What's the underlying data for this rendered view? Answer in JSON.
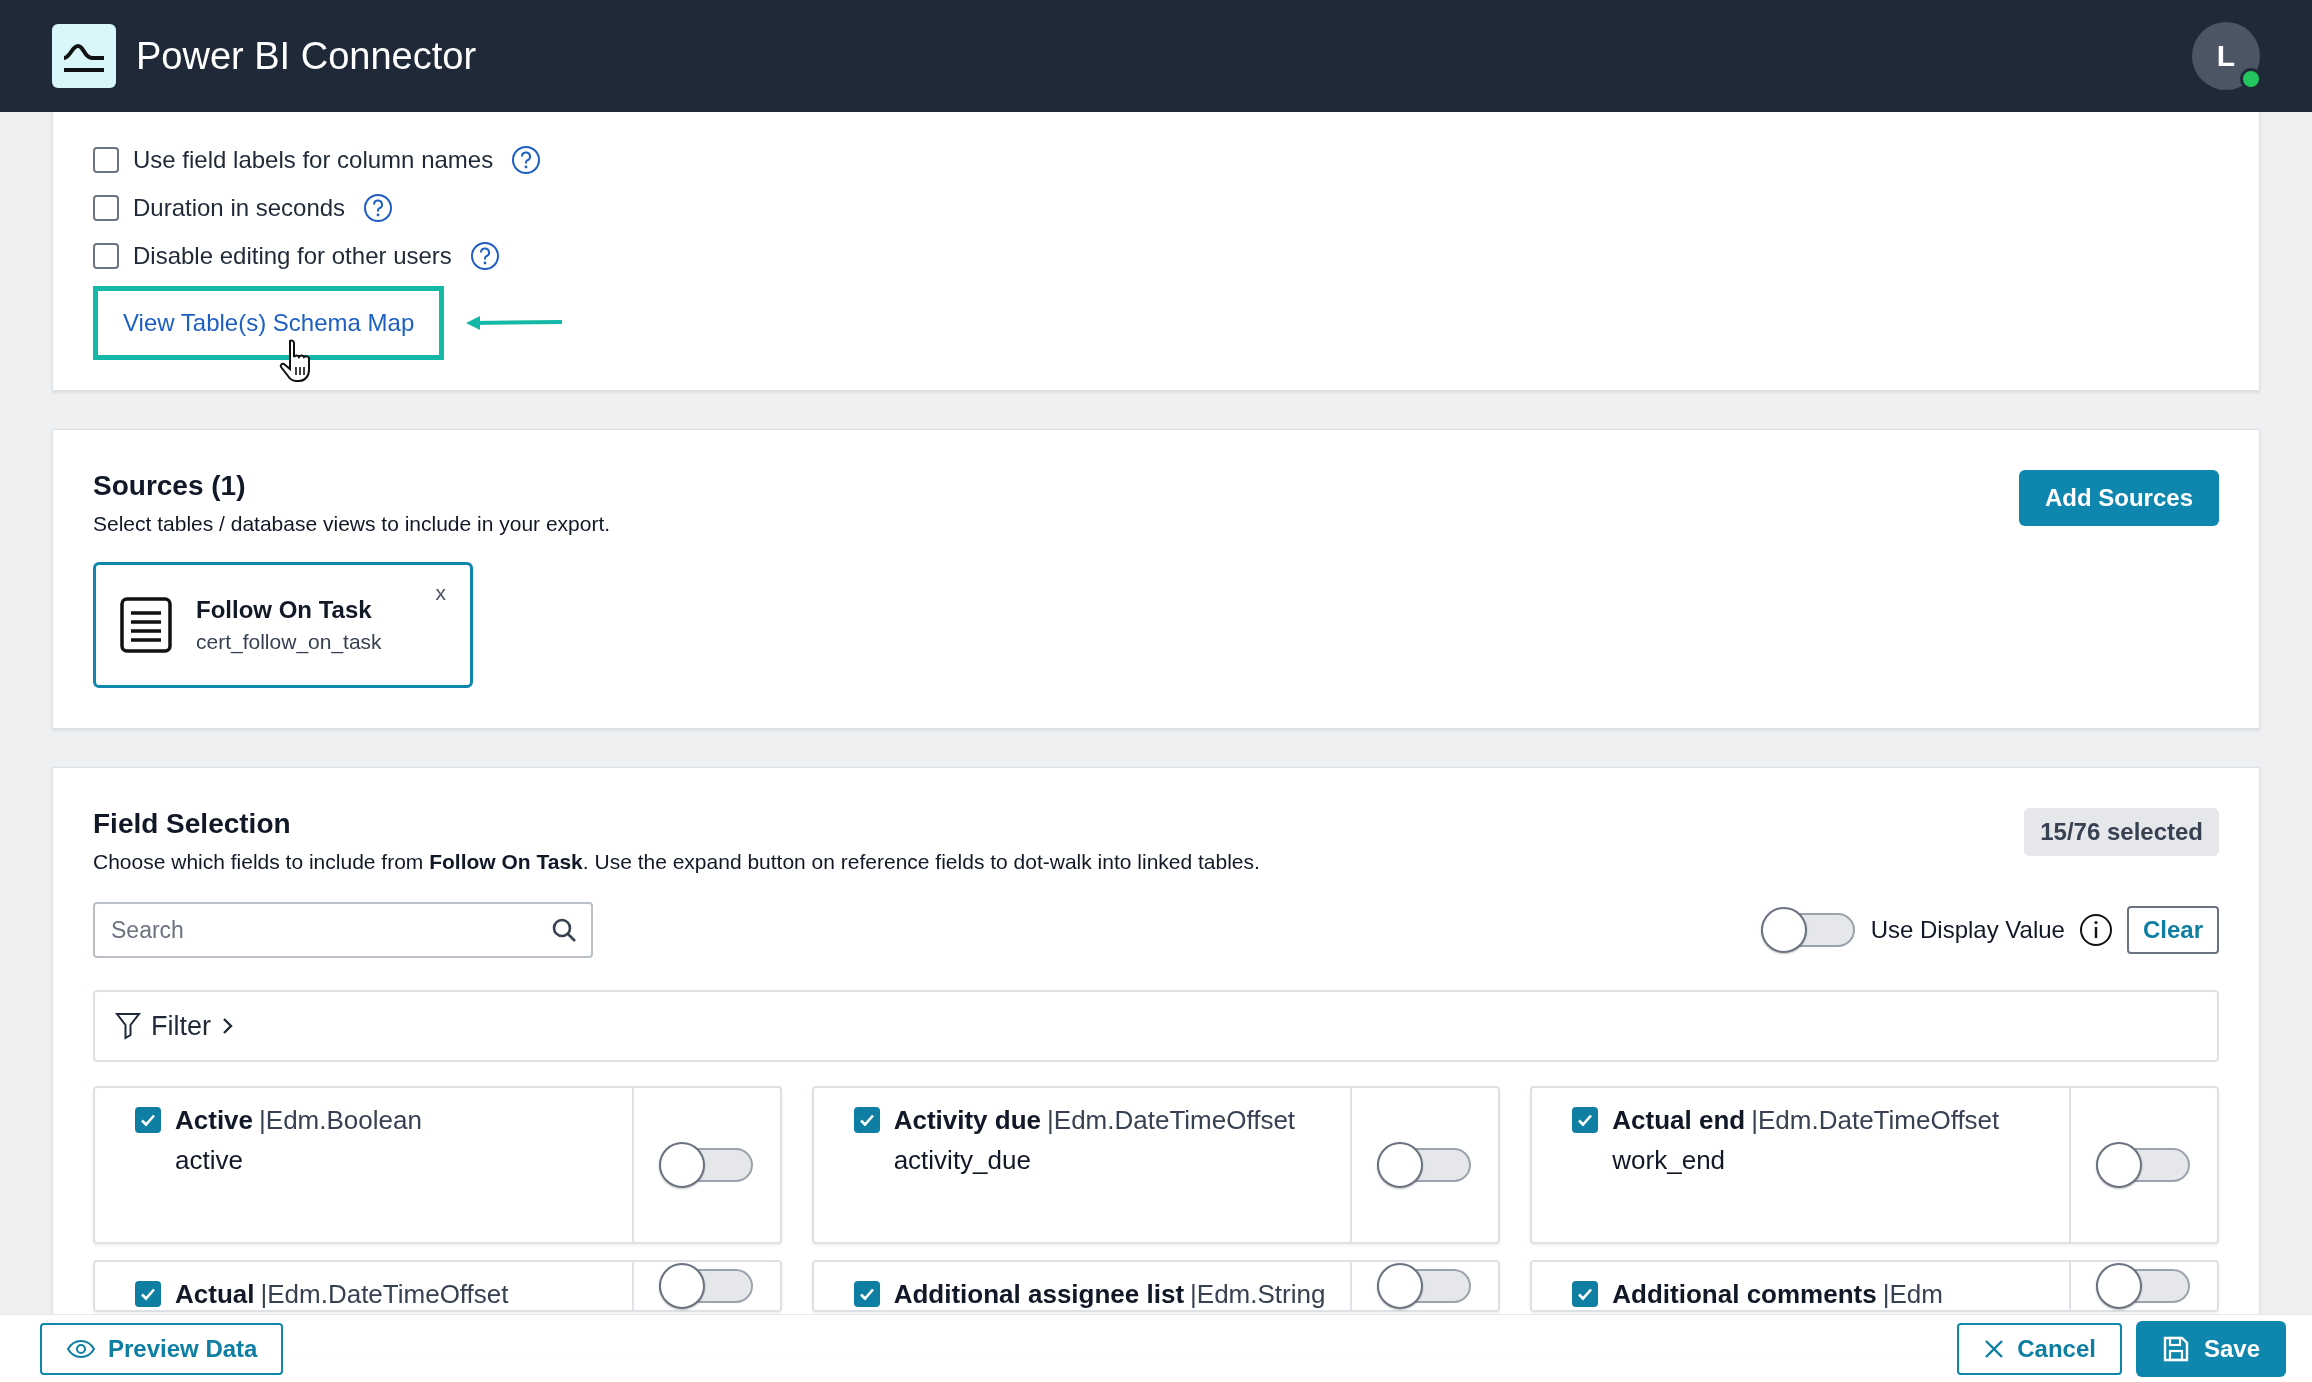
{
  "header": {
    "title": "Power BI Connector",
    "avatar": "L"
  },
  "options": [
    {
      "label": "Use field labels for column names",
      "checked": false
    },
    {
      "label": "Duration in seconds",
      "checked": false
    },
    {
      "label": "Disable editing for other users",
      "checked": false
    }
  ],
  "schema_link": "View Table(s) Schema Map",
  "sources": {
    "title": "Sources (1)",
    "description": "Select tables / database views to include in your export.",
    "add_button": "Add Sources",
    "items": [
      {
        "name": "Follow On Task",
        "table": "cert_follow_on_task",
        "remove": "x"
      }
    ]
  },
  "field_selection": {
    "title": "Field Selection",
    "description": "Choose which fields to include from **Follow On Task**. Use the expand button on reference fields to dot-walk into linked tables.",
    "count": "15/76 selected",
    "search": {
      "placeholder": "Search"
    },
    "display_value": {
      "label": "Use Display Value",
      "on": false
    },
    "clear_button": "Clear",
    "filter": "Filter",
    "fields": [
      {
        "label": "Active",
        "type": "|Edm.Boolean",
        "name": "active",
        "checked": true,
        "on": false
      },
      {
        "label": "Activity due",
        "type": "|Edm.DateTimeOffset",
        "name": "activity_due",
        "checked": true,
        "on": false
      },
      {
        "label": "Actual end",
        "type": "|Edm.DateTimeOffset",
        "name": "work_end",
        "checked": true,
        "on": false
      },
      {
        "label": "Actual",
        "type": "|Edm.DateTimeOffset",
        "checked": true,
        "on": false
      },
      {
        "label": "Additional assignee list",
        "type": "|Edm.String",
        "checked": true,
        "on": false
      },
      {
        "label": "Additional comments",
        "type": "|Edm",
        "checked": true,
        "on": false
      }
    ]
  },
  "footer": {
    "preview_button": "Preview Data",
    "cancel_button": "Cancel",
    "save_button": "Save"
  }
}
